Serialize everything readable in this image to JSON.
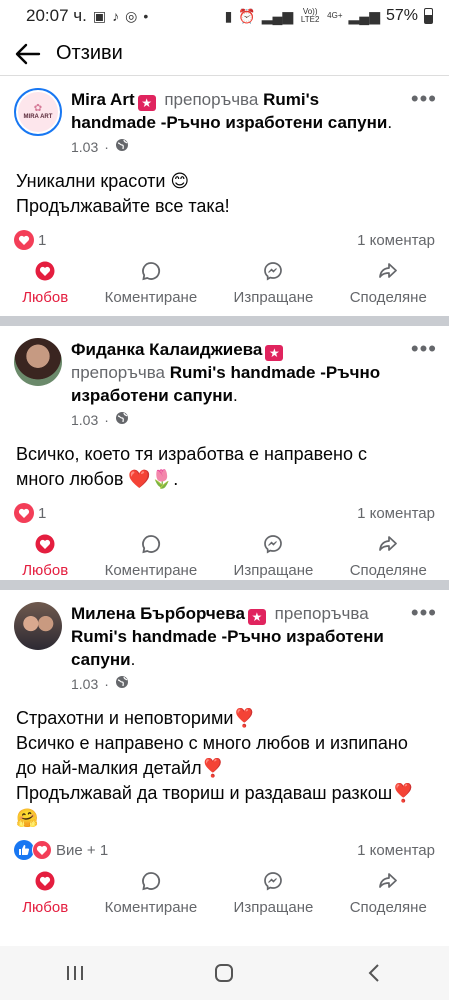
{
  "status": {
    "time": "20:07 ч.",
    "battery": "57%",
    "net1": "Vo)) LTE2",
    "net2": "4G+"
  },
  "appbar": {
    "title": "Отзиви"
  },
  "posts": [
    {
      "name": "Mira Art",
      "recommends": "препоръчва",
      "page": "Rumi's handmade -Ръчно изработени сапуни",
      "date": "1.03",
      "lines": [
        "Уникални красоти 😊",
        "Продължавайте все така!"
      ],
      "reaction_count": "1",
      "comments": "1 коментар"
    },
    {
      "name": "Фиданка Калаиджиева",
      "recommends": "препоръчва",
      "page": "Rumi's handmade -Ръчно изработени сапуни",
      "date": "1.03",
      "lines": [
        "Всичко, което тя изработва е направено с",
        "много любов ❤️🌷."
      ],
      "reaction_count": "1",
      "comments": "1 коментар"
    },
    {
      "name": "Милена Бърборчева",
      "recommends": "препоръчва",
      "page": "Rumi's handmade -Ръчно изработени сапуни",
      "date": "1.03",
      "lines": [
        "Страхотни и неповторими❣️",
        "Всичко е направено с много любов и изпипано",
        "до най-малкия детайл❣️",
        "Продължавай да твориш и раздаваш разкош❣️",
        "🤗"
      ],
      "reaction_count": "Вие + 1",
      "comments": "1 коментар"
    }
  ],
  "actions": {
    "love": "Любов",
    "comment": "Коментиране",
    "send": "Изпращане",
    "share": "Споделяне"
  },
  "avatar_text": "MIRA ART"
}
